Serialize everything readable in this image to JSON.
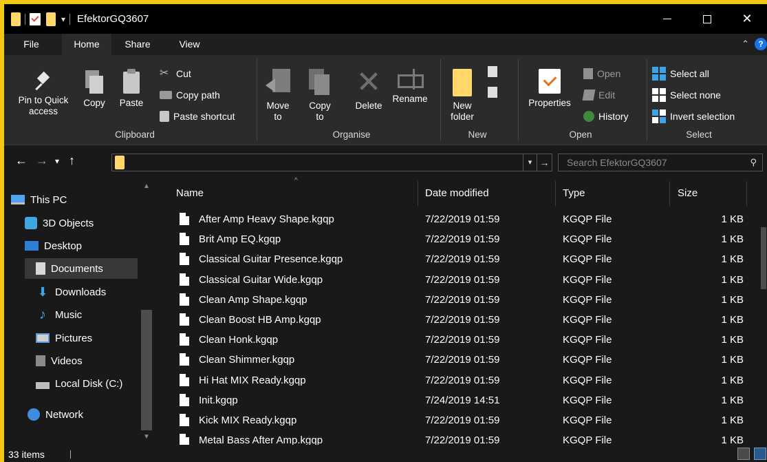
{
  "window": {
    "title": "EfektorGQ3607",
    "qa_dropdown": "▾"
  },
  "tabs": {
    "file": "File",
    "home": "Home",
    "share": "Share",
    "view": "View"
  },
  "ribbon": {
    "clipboard": {
      "label": "Clipboard",
      "pin": "Pin to Quick access",
      "copy": "Copy",
      "paste": "Paste",
      "cut": "Cut",
      "copy_path": "Copy path",
      "paste_shortcut": "Paste shortcut"
    },
    "organise": {
      "label": "Organise",
      "move_to": "Move to",
      "copy_to": "Copy to",
      "delete": "Delete",
      "rename": "Rename"
    },
    "new": {
      "label": "New",
      "new_folder": "New folder"
    },
    "open": {
      "label": "Open",
      "properties": "Properties",
      "open": "Open",
      "edit": "Edit",
      "history": "History"
    },
    "select": {
      "label": "Select",
      "select_all": "Select all",
      "select_none": "Select none",
      "invert_selection": "Invert selection"
    }
  },
  "addressbar": {
    "search_placeholder": "Search EfektorGQ3607"
  },
  "navpane": {
    "items": [
      {
        "label": "This PC",
        "icon": "computer-icon"
      },
      {
        "label": "3D Objects",
        "icon": "3d-objects-icon"
      },
      {
        "label": "Desktop",
        "icon": "desktop-icon"
      },
      {
        "label": "Documents",
        "icon": "documents-icon"
      },
      {
        "label": "Downloads",
        "icon": "downloads-icon"
      },
      {
        "label": "Music",
        "icon": "music-icon"
      },
      {
        "label": "Pictures",
        "icon": "pictures-icon"
      },
      {
        "label": "Videos",
        "icon": "videos-icon"
      },
      {
        "label": "Local Disk (C:)",
        "icon": "disk-icon"
      },
      {
        "label": "Network",
        "icon": "network-icon"
      }
    ]
  },
  "filelist": {
    "columns": {
      "name": "Name",
      "date": "Date modified",
      "type": "Type",
      "size": "Size"
    },
    "rows": [
      {
        "name": "After Amp Heavy Shape.kgqp",
        "date": "7/22/2019 01:59",
        "type": "KGQP File",
        "size": "1 KB"
      },
      {
        "name": "Brit Amp EQ.kgqp",
        "date": "7/22/2019 01:59",
        "type": "KGQP File",
        "size": "1 KB"
      },
      {
        "name": "Classical Guitar Presence.kgqp",
        "date": "7/22/2019 01:59",
        "type": "KGQP File",
        "size": "1 KB"
      },
      {
        "name": "Classical Guitar Wide.kgqp",
        "date": "7/22/2019 01:59",
        "type": "KGQP File",
        "size": "1 KB"
      },
      {
        "name": "Clean Amp Shape.kgqp",
        "date": "7/22/2019 01:59",
        "type": "KGQP File",
        "size": "1 KB"
      },
      {
        "name": "Clean Boost HB Amp.kgqp",
        "date": "7/22/2019 01:59",
        "type": "KGQP File",
        "size": "1 KB"
      },
      {
        "name": "Clean Honk.kgqp",
        "date": "7/22/2019 01:59",
        "type": "KGQP File",
        "size": "1 KB"
      },
      {
        "name": "Clean Shimmer.kgqp",
        "date": "7/22/2019 01:59",
        "type": "KGQP File",
        "size": "1 KB"
      },
      {
        "name": "Hi Hat MIX Ready.kgqp",
        "date": "7/22/2019 01:59",
        "type": "KGQP File",
        "size": "1 KB"
      },
      {
        "name": "Init.kgqp",
        "date": "7/24/2019 14:51",
        "type": "KGQP File",
        "size": "1 KB"
      },
      {
        "name": "Kick MIX Ready.kgqp",
        "date": "7/22/2019 01:59",
        "type": "KGQP File",
        "size": "1 KB"
      },
      {
        "name": "Metal Bass After Amp.kgqp",
        "date": "7/22/2019 01:59",
        "type": "KGQP File",
        "size": "1 KB"
      }
    ]
  },
  "statusbar": {
    "item_count": "33 items"
  },
  "colors": {
    "frame": "#f2c811",
    "background": "#191919",
    "ribbon": "#2b2b2b",
    "accent": "#3da3e8"
  }
}
